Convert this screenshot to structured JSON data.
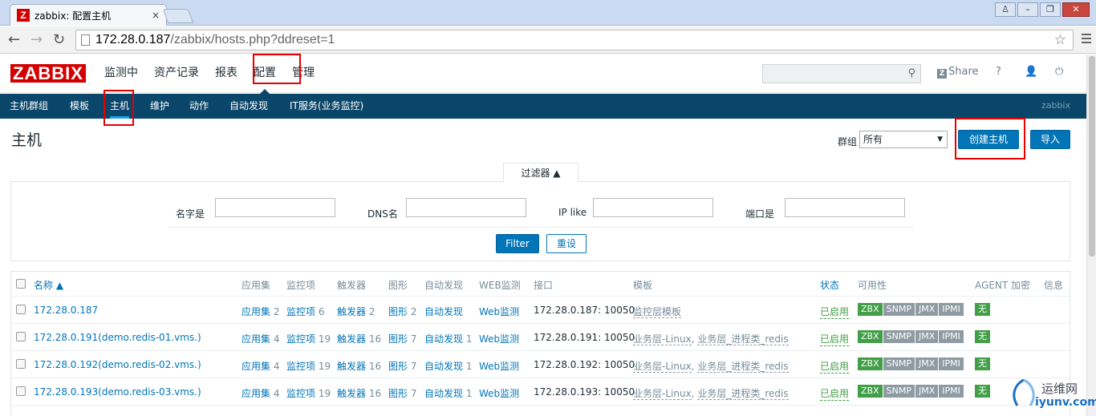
{
  "browser": {
    "tab_title": "zabbix: 配置主机",
    "tab_close": "×",
    "url_host": "172.28.0.187",
    "url_path": "/zabbix/hosts.php?ddreset=1"
  },
  "header": {
    "logo": "ZABBIX",
    "menu": [
      "监测中",
      "资产记录",
      "报表",
      "配置",
      "管理"
    ],
    "active_menu": "配置",
    "share": "Share",
    "help": "?"
  },
  "submenu": {
    "items": [
      "主机群组",
      "模板",
      "主机",
      "维护",
      "动作",
      "自动发现",
      "IT服务(业务监控)"
    ],
    "active": "主机",
    "brand": "zabbix"
  },
  "page": {
    "title": "主机",
    "group_label": "群组",
    "group_value": "所有",
    "create_button": "创建主机",
    "import_button": "导入"
  },
  "filter": {
    "tab_label": "过滤器 ▲",
    "name_label": "名字是",
    "dns_label": "DNS名",
    "ip_label": "IP like",
    "port_label": "端口是",
    "apply_button": "Filter",
    "reset_button": "重设"
  },
  "table": {
    "headers": {
      "name": "名称 ▲",
      "apps": "应用集",
      "items": "监控项",
      "triggers": "触发器",
      "graphs": "图形",
      "discovery": "自动发现",
      "web": "WEB监测",
      "interface": "接口",
      "templates": "模板",
      "status": "状态",
      "availability": "可用性",
      "agent_enc": "AGENT 加密",
      "info": "信息"
    },
    "rows": [
      {
        "name": "172.28.0.187",
        "apps": "应用集",
        "apps_n": "2",
        "items": "监控项",
        "items_n": "6",
        "triggers": "触发器",
        "triggers_n": "2",
        "graphs": "图形",
        "graphs_n": "2",
        "discovery": "自动发现",
        "discovery_n": "",
        "web": "Web监测",
        "interface": "172.28.0.187: 10050",
        "templates": "监控层模板",
        "templates2": "",
        "status": "已启用",
        "enc": "无"
      },
      {
        "name": "172.28.0.191(demo.redis-01.vms.)",
        "apps": "应用集",
        "apps_n": "4",
        "items": "监控项",
        "items_n": "19",
        "triggers": "触发器",
        "triggers_n": "16",
        "graphs": "图形",
        "graphs_n": "7",
        "discovery": "自动发现",
        "discovery_n": "1",
        "web": "Web监测",
        "interface": "172.28.0.191: 10050",
        "templates": "业务层-Linux",
        "templates2": "业务层_进程类_redis",
        "status": "已启用",
        "enc": "无"
      },
      {
        "name": "172.28.0.192(demo.redis-02.vms.)",
        "apps": "应用集",
        "apps_n": "4",
        "items": "监控项",
        "items_n": "19",
        "triggers": "触发器",
        "triggers_n": "16",
        "graphs": "图形",
        "graphs_n": "7",
        "discovery": "自动发现",
        "discovery_n": "1",
        "web": "Web监测",
        "interface": "172.28.0.192: 10050",
        "templates": "业务层-Linux",
        "templates2": "业务层_进程类_redis",
        "status": "已启用",
        "enc": "无"
      },
      {
        "name": "172.28.0.193(demo.redis-03.vms.)",
        "apps": "应用集",
        "apps_n": "4",
        "items": "监控项",
        "items_n": "19",
        "triggers": "触发器",
        "triggers_n": "16",
        "graphs": "图形",
        "graphs_n": "7",
        "discovery": "自动发现",
        "discovery_n": "1",
        "web": "Web监测",
        "interface": "172.28.0.193: 10050",
        "templates": "业务层-Linux",
        "templates2": "业务层_进程类_redis",
        "status": "已启用",
        "enc": "无"
      }
    ],
    "availability_badges": [
      "ZBX",
      "SNMP",
      "JMX",
      "IPMI"
    ]
  },
  "watermark": {
    "line1": "运维网",
    "line2": "iyunv.com"
  }
}
